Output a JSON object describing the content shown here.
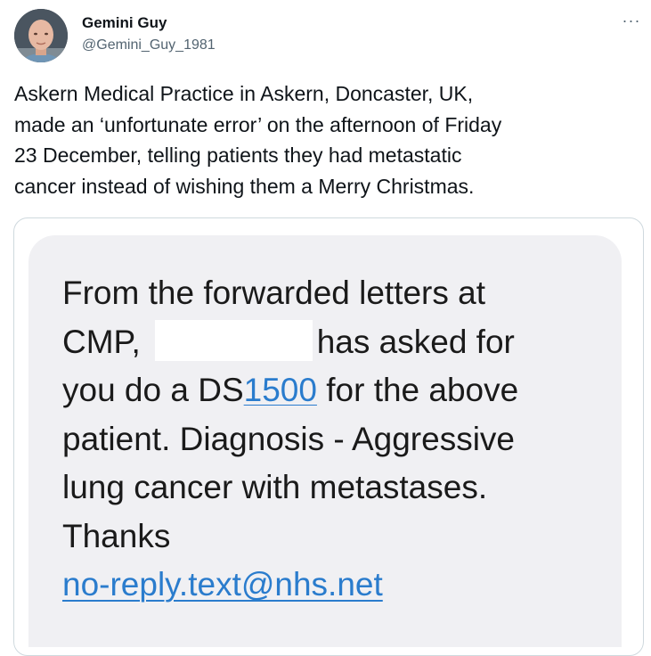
{
  "tweet": {
    "author": {
      "display_name": "Gemini Guy",
      "handle": "@Gemini_Guy_1981",
      "avatar_icon": "profile-photo"
    },
    "more_icon": "ellipsis-icon",
    "more_label": "···",
    "text_lines": [
      "Askern Medical Practice in Askern, Doncaster, UK,",
      "made an ‘unfortunate error’ on the afternoon of Friday",
      "23 December, telling patients they had metastatic",
      "cancer instead of wishing them a Merry Christmas."
    ]
  },
  "message": {
    "line1": "From the forwarded letters at",
    "line2_pre": "CMP,",
    "line2_post": "has asked for",
    "line3_pre": "you do a DS",
    "line3_link": "1500",
    "line3_post": " for the above",
    "line4": "patient.  Diagnosis - Aggressive",
    "line5": "lung cancer with metastases.",
    "line6": "Thanks",
    "email_link": "no-reply.text@nhs.net"
  },
  "colors": {
    "text": "#0f1419",
    "secondary": "#536471",
    "link": "#2a7ccd",
    "bubble": "#f0f0f3",
    "card_border": "#cfd9de"
  }
}
